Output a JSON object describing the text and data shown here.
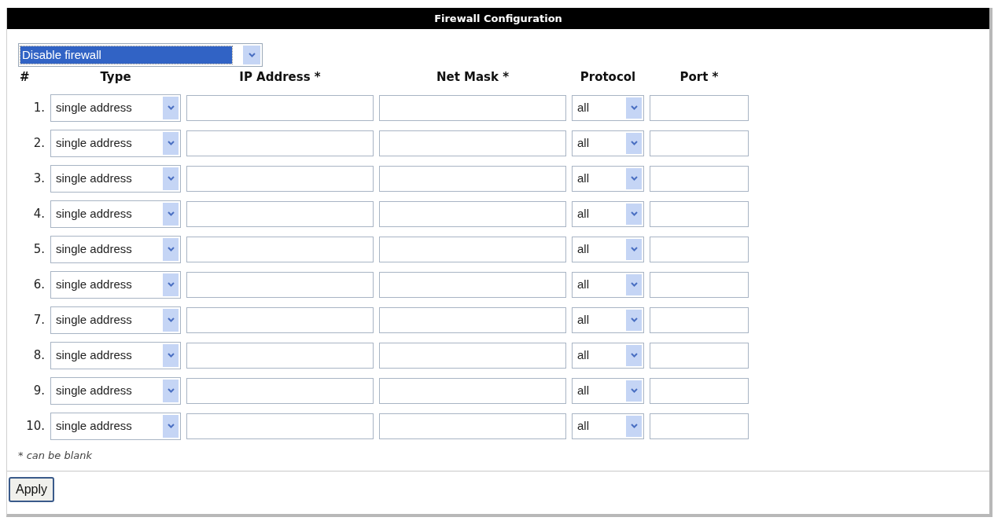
{
  "title": "Firewall Configuration",
  "mode_select": {
    "value": "Disable firewall",
    "focused": true
  },
  "columns": [
    "#",
    "Type",
    "IP Address *",
    "Net Mask *",
    "Protocol",
    "Port *"
  ],
  "rows": [
    {
      "number": "1.",
      "type": "single address",
      "protocol": "all"
    },
    {
      "number": "2.",
      "type": "single address",
      "protocol": "all"
    },
    {
      "number": "3.",
      "type": "single address",
      "protocol": "all"
    },
    {
      "number": "4.",
      "type": "single address",
      "protocol": "all"
    },
    {
      "number": "5.",
      "type": "single address",
      "protocol": "all"
    },
    {
      "number": "6.",
      "type": "single address",
      "protocol": "all"
    },
    {
      "number": "7.",
      "type": "single address",
      "protocol": "all"
    },
    {
      "number": "8.",
      "type": "single address",
      "protocol": "all"
    },
    {
      "number": "9.",
      "type": "single address",
      "protocol": "all"
    },
    {
      "number": "10.",
      "type": "single address",
      "protocol": "all"
    }
  ],
  "note": "* can be blank",
  "buttons": [
    "Apply"
  ]
}
